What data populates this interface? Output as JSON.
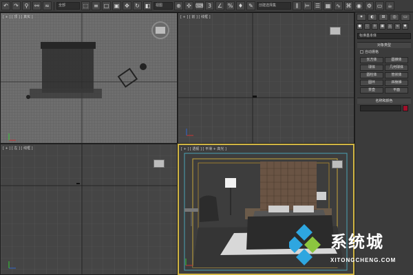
{
  "toolbar": {
    "filter_dropdown": "全部",
    "view_dropdown": "视图",
    "selection_set_dropdown": "创建选择集"
  },
  "viewports": {
    "top": {
      "label": "[ + ] [ 顶 ] [ 真实 ]"
    },
    "front": {
      "label": "[ + ] [ 前 ] [ 线框 ]"
    },
    "left": {
      "label": "[ + ] [ 左 ] [ 线框 ]"
    },
    "perspective": {
      "label": "[ + ] [ 透视 ] [ 平滑 + 高光 ]"
    }
  },
  "command_panel": {
    "category_dropdown": "标准基本体",
    "object_type_header": "对象类型",
    "autogrid_label": "自动栅格",
    "object_buttons": [
      "长方体",
      "圆锥体",
      "球体",
      "几何球体",
      "圆柱体",
      "管状体",
      "圆环",
      "四棱锥",
      "茶壶",
      "平面"
    ],
    "name_color_header": "名称和颜色",
    "swatch_color": "#a0102a"
  },
  "watermark": {
    "cn_text": "系统城",
    "url_text": "XITONGCHENG.COM"
  },
  "colors": {
    "active_border": "#d3b744",
    "viewport_bg": "#4a4a4a"
  }
}
